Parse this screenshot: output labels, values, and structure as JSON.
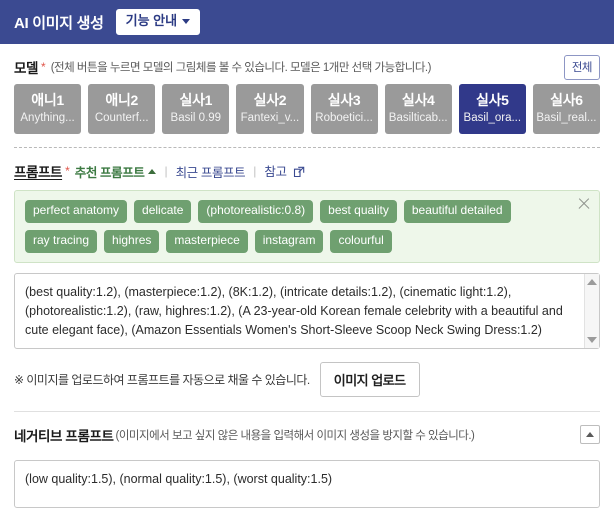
{
  "header": {
    "title": "AI 이미지 생성",
    "guide_button": "기능 안내",
    "bar_color": "#3b4a91"
  },
  "model_section": {
    "label": "모델",
    "required_mark": "*",
    "hint": "(전체 버튼을 누르면 모델의 그림체를 볼 수 있습니다. 모델은 1개만 선택 가능합니다.)",
    "all_button": "전체",
    "selected_index": 4,
    "selected_color": "#31398a",
    "card_color": "#9a9a9a",
    "cards": [
      {
        "title": "애니1",
        "subtitle": "Anything..."
      },
      {
        "title": "애니2",
        "subtitle": "Counterf..."
      },
      {
        "title": "실사1",
        "subtitle": "Basil 0.99"
      },
      {
        "title": "실사2",
        "subtitle": "Fantexi_v..."
      },
      {
        "title": "실사3",
        "subtitle": "Roboetici..."
      },
      {
        "title": "실사4",
        "subtitle": "Basilticab..."
      },
      {
        "title": "실사5",
        "subtitle": "Basil_ora..."
      },
      {
        "title": "실사6",
        "subtitle": "Basil_real..."
      }
    ]
  },
  "prompt_section": {
    "label": "프롬프트",
    "required_mark": "*",
    "suggested_link": "추천 프롬프트",
    "recent_link": "최근 프롬프트",
    "reference_link": "참고",
    "tag_panel_color": "#eef7ea",
    "tag_color": "#6fa070",
    "tags": [
      "perfect anatomy",
      "delicate",
      "(photorealistic:0.8)",
      "best quality",
      "beautiful detailed",
      "ray tracing",
      "highres",
      "masterpiece",
      "instagram",
      "colourful"
    ],
    "value": "(best quality:1.2), (masterpiece:1.2), (8K:1.2), (intricate details:1.2), (cinematic light:1.2), (photorealistic:1.2), (raw, highres:1.2), (A 23-year-old Korean female celebrity with a beautiful and cute elegant face), (Amazon Essentials Women's Short-Sleeve Scoop Neck Swing Dress:1.2)",
    "placeholder": ""
  },
  "upload_section": {
    "note": "※ 이미지를 업로드하여 프롬프트를 자동으로 채울 수 있습니다.",
    "button": "이미지 업로드"
  },
  "negative_section": {
    "label": "네거티브 프롬프트",
    "hint": "(이미지에서 보고 싶지 않은 내용을 입력해서 이미지 생성을 방지할 수 있습니다.)",
    "value": "(low quality:1.5), (normal quality:1.5), (worst quality:1.5)",
    "placeholder": ""
  }
}
